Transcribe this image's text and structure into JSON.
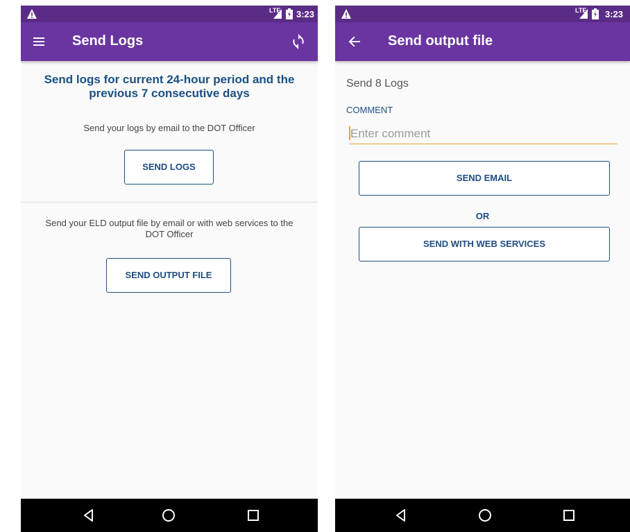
{
  "status_bar": {
    "network": "LTE",
    "time": "3:23"
  },
  "send_logs_screen": {
    "title": "Send Logs",
    "heading": "Send logs for current 24-hour period and the previous 7 consecutive days",
    "logs_caption": "Send your logs by email to the DOT Officer",
    "send_logs_label": "SEND LOGS",
    "output_caption": "Send your ELD output file by email or with web services to the DOT Officer",
    "send_output_label": "SEND OUTPUT FILE"
  },
  "send_output_screen": {
    "title": "Send output file",
    "send_count": "Send 8 Logs",
    "comment_label": "COMMENT",
    "comment_placeholder": "Enter comment",
    "comment_value": "",
    "send_email_label": "SEND EMAIL",
    "or_label": "OR",
    "send_web_label": "SEND WITH WEB SERVICES"
  },
  "colors": {
    "status_bar": "#5b2c86",
    "app_bar": "#6a35a0",
    "accent": "#1f4d80",
    "input_focus": "#f0a030"
  },
  "icons": [
    "warning-icon",
    "signal-icon",
    "battery-icon",
    "menu-icon",
    "sync-icon",
    "back-arrow-icon",
    "nav-back-icon",
    "nav-home-icon",
    "nav-recents-icon"
  ]
}
